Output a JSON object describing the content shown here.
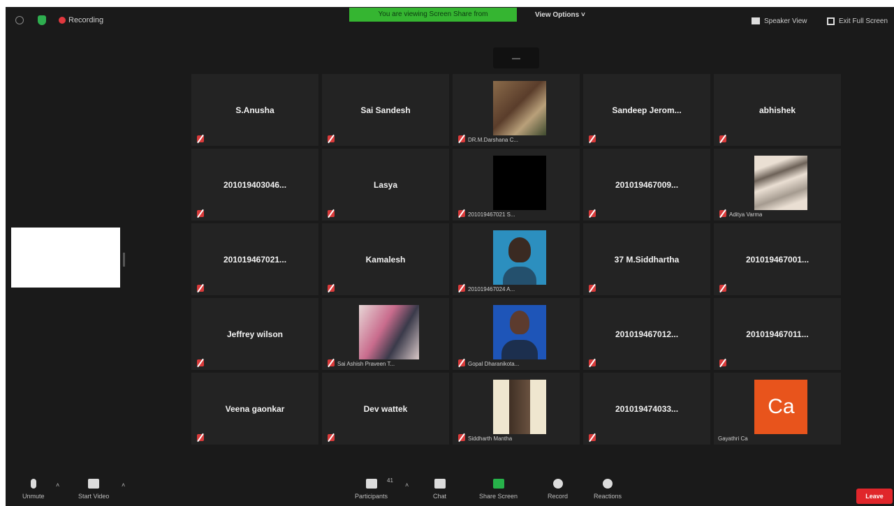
{
  "topbar": {
    "recording_label": "Recording",
    "banner_text": "You are viewing Screen Share from",
    "view_options_label": "View Options ˅",
    "speaker_view_label": "Speaker View",
    "exit_full_screen_label": "Exit Full Screen"
  },
  "grid": {
    "collapse_label": "—",
    "tiles": [
      {
        "name": "S.Anusha"
      },
      {
        "name": "Sai Sandesh"
      },
      {
        "name": "",
        "caption": "DR.M.Darshana C..."
      },
      {
        "name": "Sandeep Jerom..."
      },
      {
        "name": "abhishek"
      },
      {
        "name": "201019403046..."
      },
      {
        "name": "Lasya"
      },
      {
        "name": "",
        "caption": "201019467021 S..."
      },
      {
        "name": "201019467009..."
      },
      {
        "name": "",
        "caption": "Aditya Varma"
      },
      {
        "name": "201019467021..."
      },
      {
        "name": "Kamalesh"
      },
      {
        "name": "",
        "caption": "201019467024 A..."
      },
      {
        "name": "37 M.Siddhartha"
      },
      {
        "name": "201019467001..."
      },
      {
        "name": "Jeffrey wilson"
      },
      {
        "name": "",
        "caption": "Sai Ashish Praveen T..."
      },
      {
        "name": "",
        "caption": "Gopal Dharanikota..."
      },
      {
        "name": "201019467012..."
      },
      {
        "name": "201019467011..."
      },
      {
        "name": "Veena gaonkar"
      },
      {
        "name": "Dev wattek"
      },
      {
        "name": "",
        "caption": "Siddharth Mantha"
      },
      {
        "name": "201019474033..."
      },
      {
        "name": "",
        "caption": "Gayathri Ca",
        "initials": "Ca"
      }
    ]
  },
  "toolbar": {
    "unmute_label": "Unmute",
    "start_video_label": "Start Video",
    "participants_label": "Participants",
    "participants_count": "41",
    "chat_label": "Chat",
    "share_screen_label": "Share Screen",
    "record_label": "Record",
    "reactions_label": "Reactions",
    "leave_label": "Leave"
  },
  "colors": {
    "background": "#1a1a1a",
    "tile": "#232323",
    "banner_green": "#35b531",
    "leave_red": "#e0262b",
    "avatar_orange": "#e8541c"
  }
}
